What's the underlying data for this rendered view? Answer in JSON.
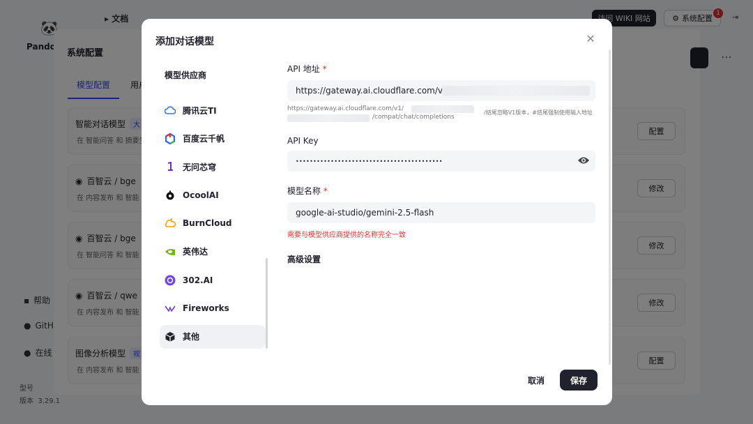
{
  "background": {
    "breadcrumb": "文档",
    "wiki_button": "访问 WIKI 网站",
    "sys_button": "系统配置",
    "notif_count": "1",
    "logo_text": "Pando",
    "panel_title": "系统配置",
    "tabs": [
      "模型配置",
      "用户"
    ],
    "sidebar": [
      "帮助",
      "GitH",
      "在线"
    ],
    "footer": [
      "型号",
      "版本",
      "3.29.1"
    ],
    "cards": [
      {
        "title": "智能对话模型",
        "tag": "大",
        "sub": "在 智能问答 和 摘要生",
        "button": "配置"
      },
      {
        "title": "百智云 / bge",
        "tag": "",
        "sub": "在 内容发布 和 智能",
        "button": "修改"
      },
      {
        "title": "百智云 / bge",
        "tag": "",
        "sub": "在 智能问答 和 智能",
        "button": "修改"
      },
      {
        "title": "百智云 / qwe",
        "tag": "",
        "sub": "在 内容发布 和 智能",
        "button": "修改"
      },
      {
        "title": "图像分析模型",
        "tag": "视",
        "sub": "在 内容发布 和 智能",
        "button": "配置"
      }
    ]
  },
  "modal": {
    "title": "添加对话模型",
    "provider_heading": "模型供应商",
    "providers": [
      {
        "name": "腾讯云TI",
        "icon": "cloud-icon",
        "color": "#1c7cf4"
      },
      {
        "name": "百度云千帆",
        "icon": "qianfan-icon",
        "color": "#2a6df4"
      },
      {
        "name": "无问芯穹",
        "icon": "infini-icon",
        "color": "#7b2cbf"
      },
      {
        "name": "OcoolAI",
        "icon": "ocool-icon",
        "color": "#111111"
      },
      {
        "name": "BurnCloud",
        "icon": "burncloud-icon",
        "color": "#f59f00"
      },
      {
        "name": "英伟达",
        "icon": "nvidia-icon",
        "color": "#76b900"
      },
      {
        "name": "302.AI",
        "icon": "ai302-icon",
        "color": "#7048e8"
      },
      {
        "name": "Fireworks",
        "icon": "fireworks-icon",
        "color": "#6a3fd0"
      },
      {
        "name": "其他",
        "icon": "cube-icon",
        "color": "#21222d"
      }
    ],
    "active_provider": "其他",
    "form": {
      "api_url_label": "API 地址",
      "api_url_value": "https://gateway.ai.cloudflare.com/v1/",
      "api_url_hint_1": "https://gateway.ai.cloudflare.com/v1/",
      "api_url_hint_2": "/compat/chat/completions",
      "api_url_hint_3": "/结尾忽略V1版本，#结尾强制使用输入地址",
      "api_key_label": "API Key",
      "api_key_value": "••••••••••••••••••••••••••••••••••••••••••",
      "model_label": "模型名称",
      "model_value": "google-ai-studio/gemini-2.5-flash",
      "model_error": "需要与模型供应商提供的名称完全一致",
      "advanced": "高级设置"
    },
    "cancel": "取消",
    "save": "保存"
  }
}
